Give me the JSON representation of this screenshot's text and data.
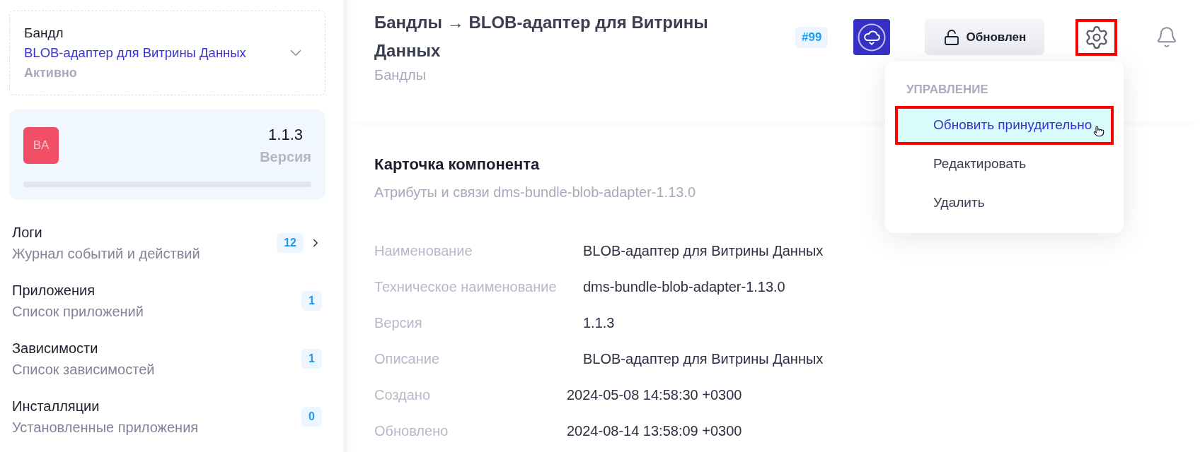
{
  "sidebar": {
    "selector": {
      "label": "Бандл",
      "value": "BLOB-адаптер для Витрины Данных",
      "status": "Активно"
    },
    "version_card": {
      "initials": "BA",
      "version": "1.1.3",
      "version_label": "Версия"
    },
    "nav_items": [
      {
        "title": "Логи",
        "subtitle": "Журнал событий и действий",
        "count": "12",
        "hovered": true
      },
      {
        "title": "Приложения",
        "subtitle": "Список приложений",
        "count": "1",
        "hovered": false
      },
      {
        "title": "Зависимости",
        "subtitle": "Список зависимостей",
        "count": "1",
        "hovered": false
      },
      {
        "title": "Инсталляции",
        "subtitle": "Установленные приложения",
        "count": "0",
        "hovered": false
      }
    ]
  },
  "header": {
    "title": "Бандлы → BLOB-адаптер для Витрины Данных",
    "subtitle": "Бандлы",
    "id_badge": "#99",
    "status_button": "Обновлен",
    "settings": {
      "highlighted": true
    }
  },
  "menu": {
    "section": "УПРАВЛЕНИЕ",
    "items": [
      {
        "label": "Обновить принудительно",
        "hovered": true,
        "highlighted": true
      },
      {
        "label": "Редактировать",
        "hovered": false,
        "highlighted": false
      },
      {
        "label": "Удалить",
        "hovered": false,
        "highlighted": false
      }
    ]
  },
  "card": {
    "title": "Карточка компонента",
    "subtitle": "Атрибуты и связи dms-bundle-blob-adapter-1.13.0",
    "fields": [
      {
        "label": "Наименование",
        "value": "BLOB-адаптер для Витрины Данных",
        "kind": "text"
      },
      {
        "label": "Техническое наименование",
        "value": "dms-bundle-blob-adapter-1.13.0",
        "kind": "text"
      },
      {
        "label": "Версия",
        "value": "1.1.3",
        "kind": "text"
      },
      {
        "label": "Описание",
        "value": "BLOB-адаптер для Витрины Данных",
        "kind": "text"
      },
      {
        "label": "Создано",
        "value": "2024-05-08 14:58:30 +0300",
        "kind": "timestamp"
      },
      {
        "label": "Обновлено",
        "value": "2024-08-14 13:58:09 +0300",
        "kind": "timestamp"
      }
    ]
  }
}
